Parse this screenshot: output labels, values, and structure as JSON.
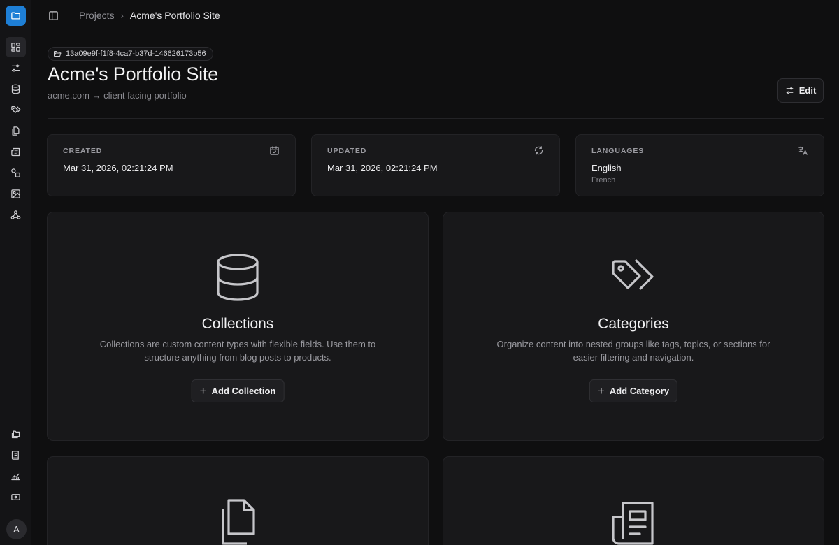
{
  "breadcrumb": {
    "root": "Projects",
    "current": "Acme's Portfolio Site"
  },
  "project": {
    "id": "13a09e9f-f1f8-4ca7-b37d-146626173b56",
    "title": "Acme's Portfolio Site",
    "subtitle": "acme.com → client facing portfolio",
    "edit_label": "Edit"
  },
  "stats": {
    "created": {
      "label": "CREATED",
      "value": "Mar 31, 2026, 02:21:24 PM",
      "icon": "calendar-check-icon"
    },
    "updated": {
      "label": "UPDATED",
      "value": "Mar 31, 2026, 02:21:24 PM",
      "icon": "refresh-icon"
    },
    "languages": {
      "label": "LANGUAGES",
      "value": "English",
      "sub": "French",
      "icon": "translate-icon"
    }
  },
  "cards": {
    "collections": {
      "title": "Collections",
      "description": "Collections are custom content types with flexible fields. Use them to structure anything from blog posts to products.",
      "button": "Add Collection"
    },
    "categories": {
      "title": "Categories",
      "description": "Organize content into nested groups like tags, topics, or sections for easier filtering and navigation.",
      "button": "Add Category"
    }
  },
  "user": {
    "avatar_initial": "A"
  },
  "colors": {
    "accent": "#1e7fd6",
    "background": "#0f0f10",
    "card": "#18181a"
  }
}
